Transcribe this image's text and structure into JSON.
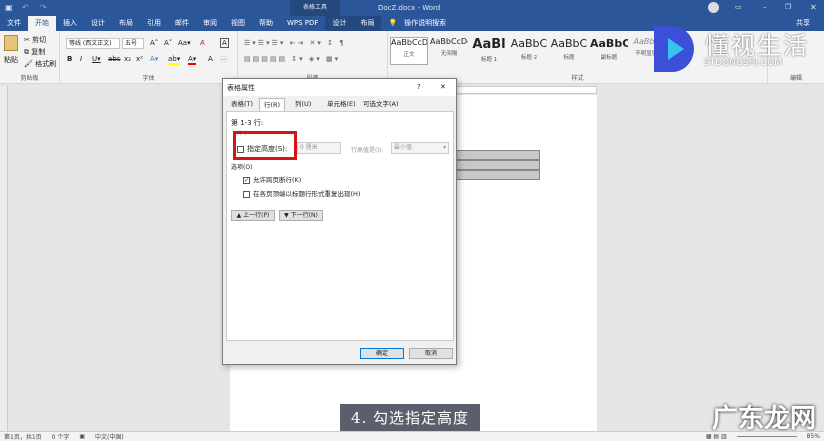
{
  "titlebar": {
    "context": "表格工具",
    "doc": "DocZ.docx - Word",
    "share": "共享"
  },
  "tabs": [
    "文件",
    "开始",
    "插入",
    "设计",
    "布局",
    "引用",
    "邮件",
    "审阅",
    "视图",
    "帮助",
    "WPS PDF",
    "设计",
    "布局"
  ],
  "tell_me": "操作说明搜索",
  "clipboard": {
    "paste": "粘贴",
    "cut": "剪切",
    "copy": "复制",
    "format_painter": "格式刷",
    "label": "剪贴板"
  },
  "font": {
    "name": "等线 (西文正文)",
    "size": "五号",
    "label": "字体"
  },
  "paragraph_label": "段落",
  "styles": {
    "label": "样式",
    "items": [
      {
        "sample": "AaBbCcDc",
        "name": "正文"
      },
      {
        "sample": "AaBbCcDc",
        "name": "无间隔"
      },
      {
        "sample": "AaBl",
        "name": "标题 1"
      },
      {
        "sample": "AaBbC",
        "name": "标题 2"
      },
      {
        "sample": "AaBbC",
        "name": "标题"
      },
      {
        "sample": "AaBbC",
        "name": "副标题"
      },
      {
        "sample": "AaBbCc",
        "name": "不明显强调"
      }
    ]
  },
  "editing_label": "编辑",
  "watermark": {
    "brand": "懂视生活",
    "sub": "STDONGSHI.COM",
    "bottom": "广东龙网"
  },
  "dialog": {
    "title": "表格属性",
    "help": "?",
    "close": "✕",
    "tabs": [
      "表格(T)",
      "行(R)",
      "列(U)",
      "单元格(E)",
      "可选文字(A)"
    ],
    "rows_label": "第 1-3 行:",
    "size_label": "尺寸",
    "specify_height": "指定高度(S):",
    "height_value": "0 厘米",
    "height_rule_label": "行高值是(I):",
    "height_rule": "最小值",
    "options_label": "选项(O)",
    "allow_break": "允许跨页断行(K)",
    "repeat_header": "在各页顶端以标题行形式重复出现(H)",
    "prev_row": "▲ 上一行(P)",
    "next_row": "▼ 下一行(N)",
    "ok": "确定",
    "cancel": "取消"
  },
  "status": {
    "page": "第1页，共1页",
    "words": "0 个字",
    "lang": "中文(中国)",
    "zoom": "85%"
  },
  "caption": "4. 勾选指定高度"
}
